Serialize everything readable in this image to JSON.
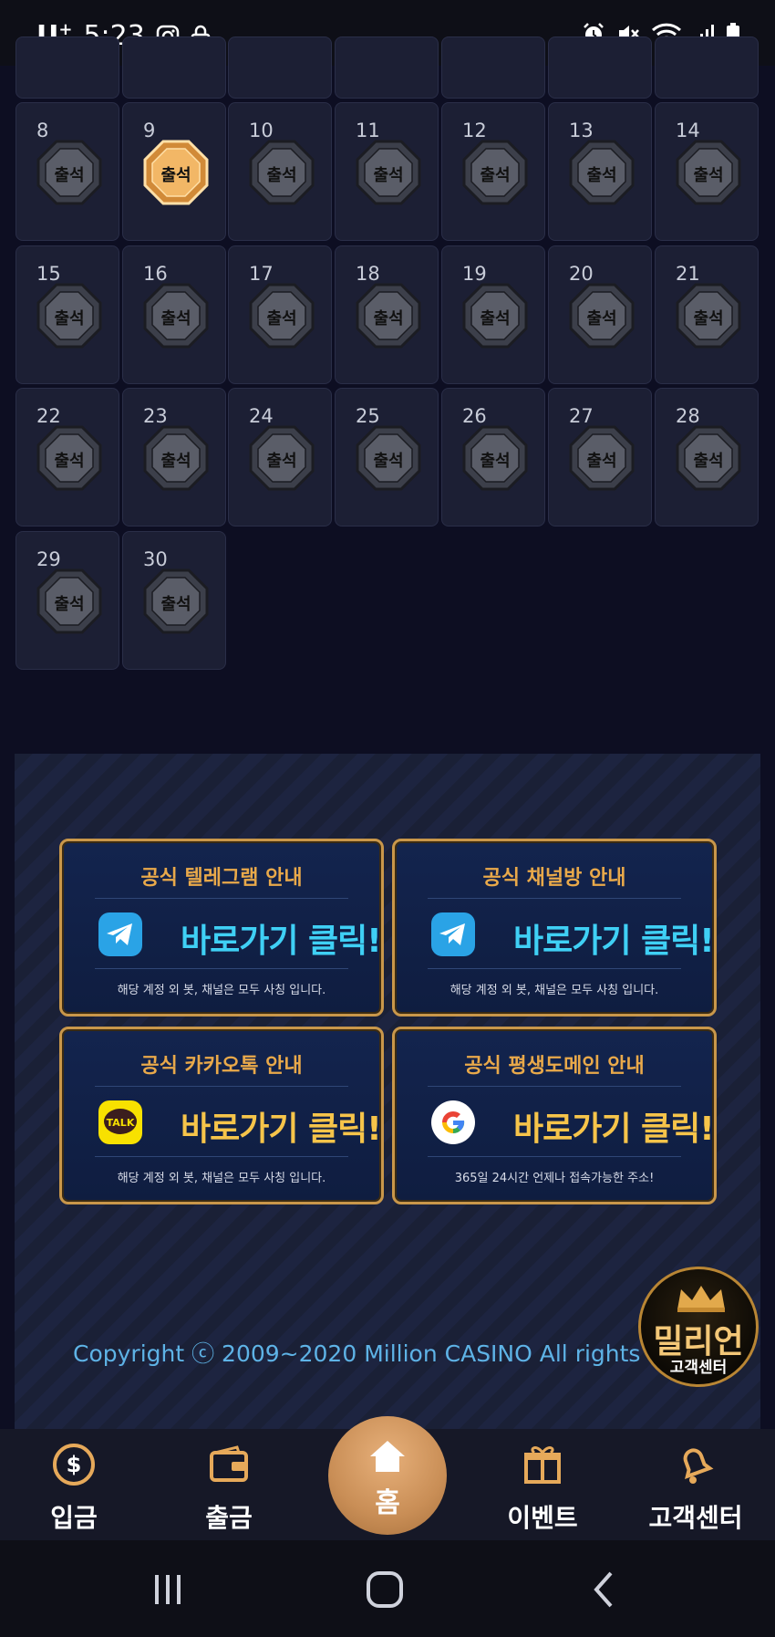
{
  "status_bar": {
    "carrier": "U",
    "carrier_sup": "+",
    "time": "5:23"
  },
  "calendar": {
    "stamp_label": "출석",
    "days": [
      {
        "day": "8",
        "checked": false
      },
      {
        "day": "9",
        "checked": true
      },
      {
        "day": "10",
        "checked": false
      },
      {
        "day": "11",
        "checked": false
      },
      {
        "day": "12",
        "checked": false
      },
      {
        "day": "13",
        "checked": false
      },
      {
        "day": "14",
        "checked": false
      },
      {
        "day": "15",
        "checked": false
      },
      {
        "day": "16",
        "checked": false
      },
      {
        "day": "17",
        "checked": false
      },
      {
        "day": "18",
        "checked": false
      },
      {
        "day": "19",
        "checked": false
      },
      {
        "day": "20",
        "checked": false
      },
      {
        "day": "21",
        "checked": false
      },
      {
        "day": "22",
        "checked": false
      },
      {
        "day": "23",
        "checked": false
      },
      {
        "day": "24",
        "checked": false
      },
      {
        "day": "25",
        "checked": false
      },
      {
        "day": "26",
        "checked": false
      },
      {
        "day": "27",
        "checked": false
      },
      {
        "day": "28",
        "checked": false
      },
      {
        "day": "29",
        "checked": false
      },
      {
        "day": "30",
        "checked": false
      }
    ]
  },
  "promos": {
    "telegram": {
      "title": "공식 텔레그램 안내",
      "button": "바로가기 클릭!",
      "note": "해당 계정 외 봇, 채널은 모두 사칭 입니다.",
      "icon": "telegram-icon"
    },
    "channel": {
      "title": "공식 채널방 안내",
      "button": "바로가기 클릭!",
      "note": "해당 계정 외 봇, 채널은 모두 사칭 입니다.",
      "icon": "telegram-icon"
    },
    "kakao": {
      "title": "공식 카카오톡 안내",
      "button": "바로가기 클릭!",
      "note": "해당 계정 외 봇, 채널은 모두 사칭 입니다.",
      "icon": "kakaotalk-icon",
      "icon_text": "TALK"
    },
    "domain": {
      "title": "공식 평생도메인 안내",
      "button": "바로가기 클릭!",
      "note": "365일 24시간 언제나 접속가능한 주소!",
      "icon": "google-icon"
    }
  },
  "copyright": "Copyright ⓒ 2009~2020 Million CASINO All rights reserved.",
  "cs_badge": {
    "title": "밀리언",
    "subtitle": "고객센터"
  },
  "bottom_nav": {
    "deposit": "입금",
    "withdraw": "출금",
    "home": "홈",
    "event": "이벤트",
    "support": "고객센터"
  },
  "colors": {
    "accent_gold": "#e9a94a",
    "button_blue": "#3fd0f5",
    "button_yellow": "#f6c44a",
    "copyright_blue": "#5eb3e6"
  }
}
